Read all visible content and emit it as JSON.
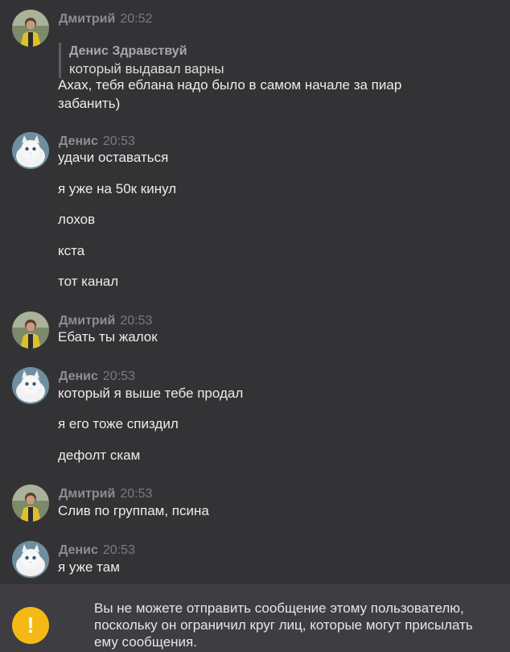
{
  "messages": [
    {
      "author": "Дмитрий",
      "time": "20:52",
      "quote": {
        "author": "Денис Здравствуй",
        "text": "который выдавал варны"
      },
      "lines": [
        "Ахах, тебя еблана надо было в самом начале за пиар",
        "забанить)"
      ]
    },
    {
      "author": "Денис",
      "time": "20:53",
      "lines": [
        "удачи оставаться",
        "я уже на 50к кинул",
        "лохов",
        "кста",
        "тот канал"
      ]
    },
    {
      "author": "Дмитрий",
      "time": "20:53",
      "lines": [
        "Ебать ты жалок"
      ]
    },
    {
      "author": "Денис",
      "time": "20:53",
      "lines": [
        "который я выше тебе продал",
        "я его тоже спиздил",
        "дефолт скам"
      ]
    },
    {
      "author": "Дмитрий",
      "time": "20:53",
      "lines": [
        "Слив по группам, псина"
      ]
    },
    {
      "author": "Денис",
      "time": "20:53",
      "lines": [
        "я уже там"
      ]
    }
  ],
  "notice": {
    "icon": "warning-icon",
    "icon_glyph": "!",
    "text": "Вы не можете отправить сообщение этому пользователю, поскольку он ограничил круг лиц, которые могут присылать ему сообщения."
  },
  "colors": {
    "background": "#333336",
    "notice_background": "#3e3e42",
    "warning": "#f5b915"
  }
}
